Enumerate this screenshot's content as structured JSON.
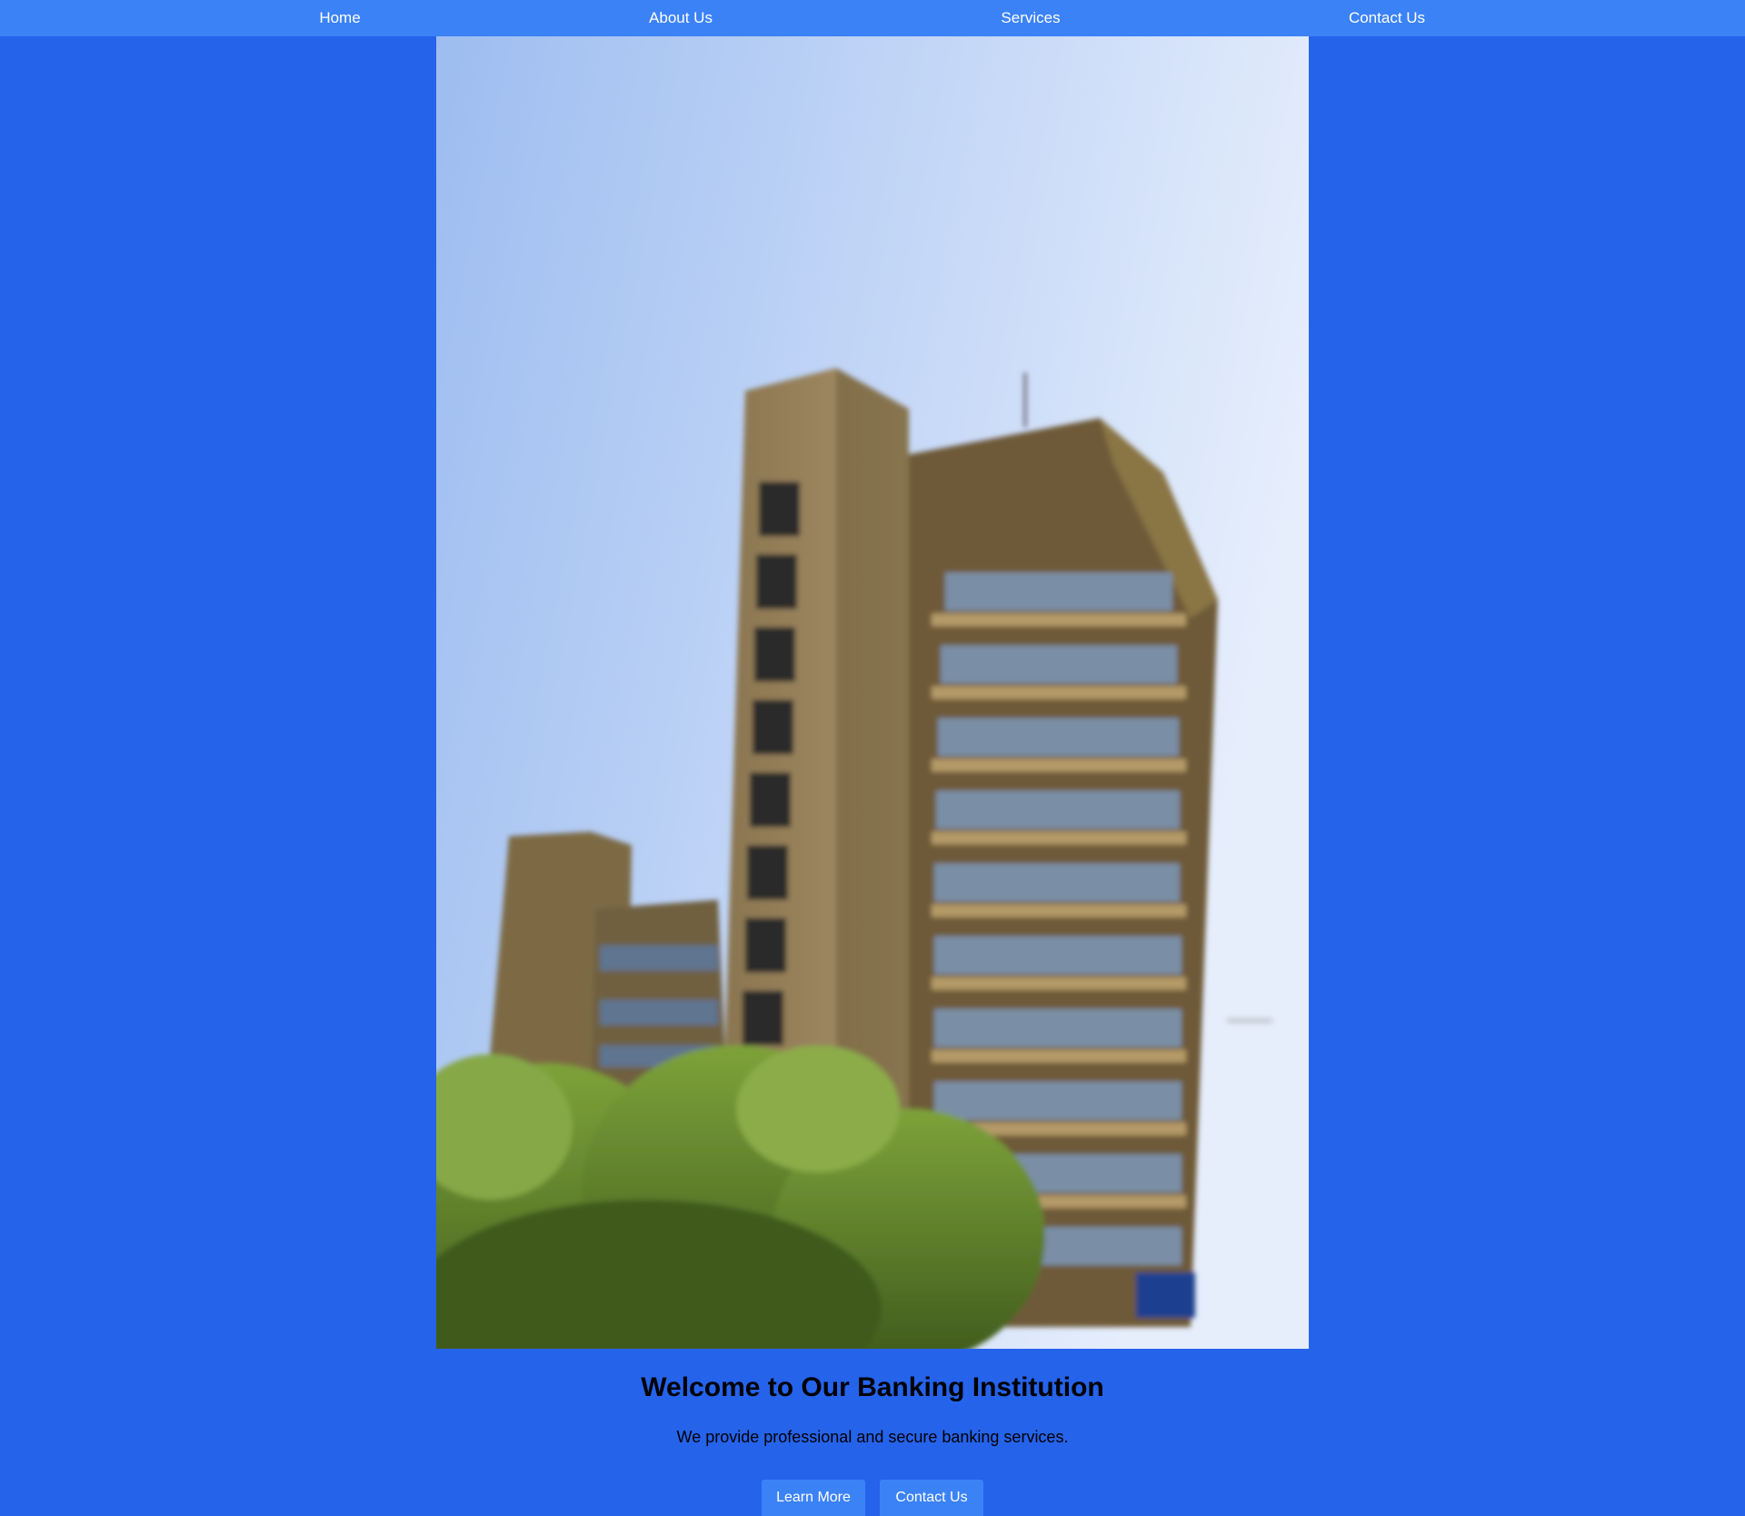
{
  "nav": {
    "items": [
      {
        "label": "Home"
      },
      {
        "label": "About Us"
      },
      {
        "label": "Services"
      },
      {
        "label": "Contact Us"
      }
    ]
  },
  "hero": {
    "image_icon": "building-photo",
    "title": "Welcome to Our Banking Institution",
    "subtitle": "We provide professional and secure banking services.",
    "buttons": {
      "learn_more": "Learn More",
      "contact_us": "Contact Us"
    }
  },
  "colors": {
    "page_background": "#2563eb",
    "nav_background": "#3b82f6",
    "button_background": "#3b82f6",
    "nav_text": "#ffffff",
    "heading_text": "#000000"
  }
}
